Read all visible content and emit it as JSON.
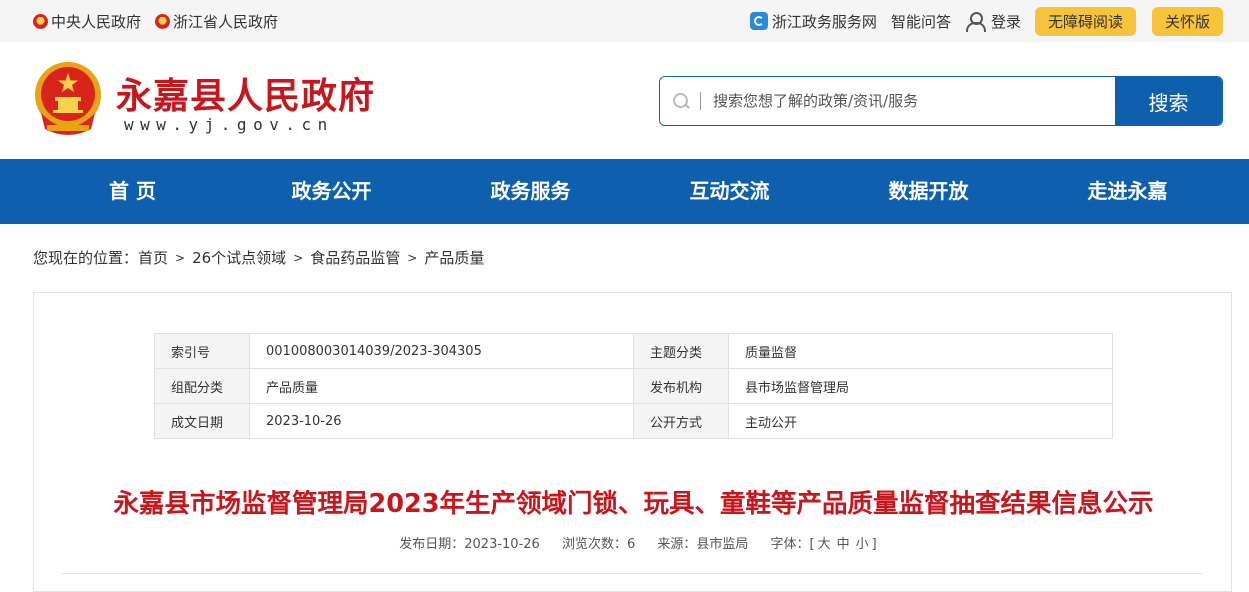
{
  "topbar": {
    "left_links": [
      {
        "icon": "national-emblem-icon",
        "label": "中央人民政府"
      },
      {
        "icon": "national-emblem-icon",
        "label": "浙江省人民政府"
      }
    ],
    "zwfw_label": "浙江政务服务网",
    "qa_label": "智能问答",
    "login_label": "登录",
    "accessibility_label": "无障碍阅读",
    "elderly_label": "关怀版",
    "pill_color": "#f7c33a"
  },
  "header": {
    "title": "永嘉县人民政府",
    "url": "www.yj.gov.cn",
    "search_placeholder": "搜索您想了解的政策/资讯/服务",
    "search_button": "搜索",
    "brand_color": "#c8161d",
    "accent_color": "#0e5fae"
  },
  "nav": {
    "items": [
      "首 页",
      "政务公开",
      "政务服务",
      "互动交流",
      "数据开放",
      "走进永嘉"
    ]
  },
  "breadcrumb": {
    "prefix": "您现在的位置：",
    "items": [
      "首页",
      "26个试点领域",
      "食品药品监管",
      "产品质量"
    ]
  },
  "meta": {
    "rows": [
      {
        "k1": "索引号",
        "v1": "001008003014039/2023-304305",
        "k2": "主题分类",
        "v2": "质量监督"
      },
      {
        "k1": "组配分类",
        "v1": "产品质量",
        "k2": "发布机构",
        "v2": "县市场监督管理局"
      },
      {
        "k1": "成文日期",
        "v1": "2023-10-26",
        "k2": "公开方式",
        "v2": "主动公开"
      }
    ]
  },
  "article": {
    "title": "永嘉县市场监督管理局2023年生产领域门锁、玩具、童鞋等产品质量监督抽查结果信息公示",
    "publish_date": "发布日期：2023-10-26",
    "views": "浏览次数：6",
    "source": "来源：县市监局",
    "font_size_label": "字体：[",
    "font_large": "大",
    "font_medium": "中",
    "font_small": "小",
    "font_close": "]"
  }
}
